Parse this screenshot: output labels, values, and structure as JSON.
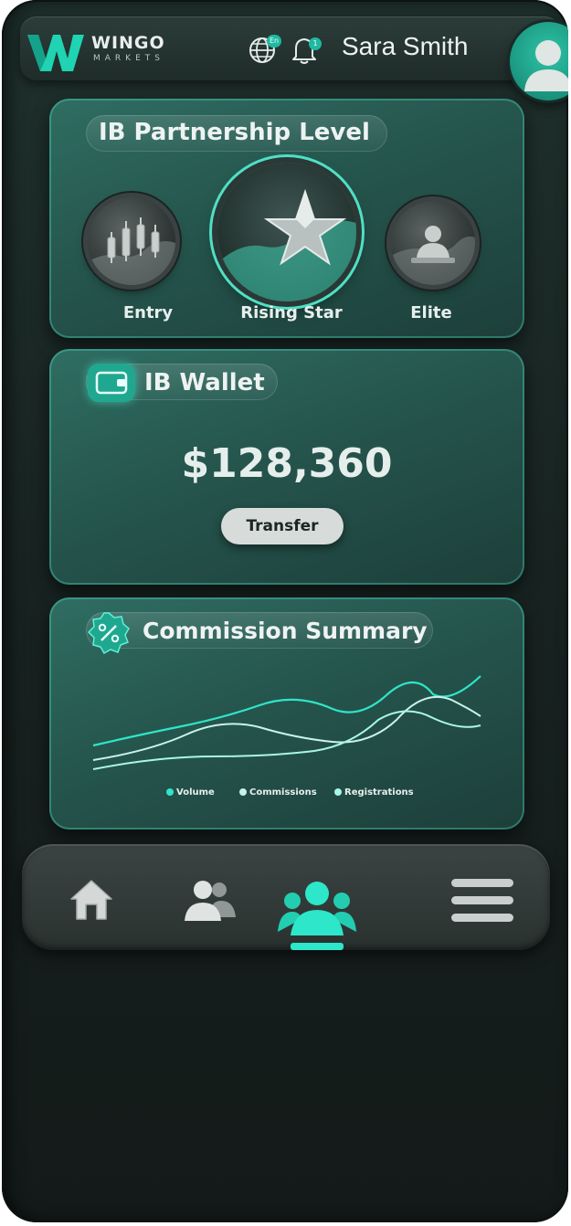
{
  "header": {
    "brand": "WINGO",
    "brand_sub": "MARKETS",
    "language_badge": "En",
    "notification_count": "1",
    "user_name": "Sara Smith"
  },
  "level_card": {
    "title": "IB Partnership Level",
    "levels": [
      {
        "label": "Entry"
      },
      {
        "label": "Rising Star"
      },
      {
        "label": "Elite"
      }
    ]
  },
  "wallet_card": {
    "title": "IB Wallet",
    "amount": "$128,360",
    "transfer_label": "Transfer"
  },
  "commission_card": {
    "title": "Commission Summary"
  },
  "chart_data": {
    "type": "line",
    "series": [
      {
        "name": "Volume",
        "color": "#2ee6c9"
      },
      {
        "name": "Commissions",
        "color": "#c7f3ea"
      },
      {
        "name": "Registrations",
        "color": "#a9f7e6"
      }
    ],
    "grid": false,
    "legend": "bottom"
  },
  "nav": {
    "items": [
      {
        "icon": "home-icon"
      },
      {
        "icon": "users-icon"
      },
      {
        "icon": "team-icon",
        "active": true
      },
      {
        "icon": "menu-icon"
      }
    ]
  },
  "colors": {
    "accent": "#2ee6c9",
    "card": "#25554d",
    "background": "#17211f"
  }
}
